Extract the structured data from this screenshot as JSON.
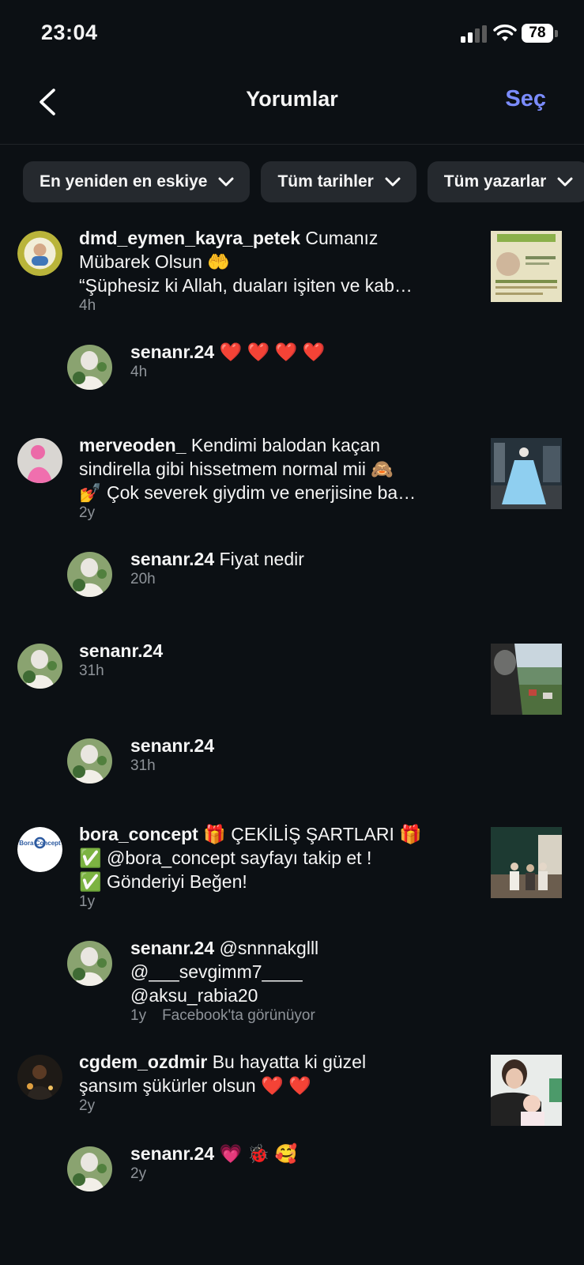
{
  "status_bar": {
    "time": "23:04",
    "battery": "78"
  },
  "header": {
    "title": "Yorumlar",
    "select": "Seç"
  },
  "filters": [
    {
      "label": "En yeniden en eskiye"
    },
    {
      "label": "Tüm tarihler"
    },
    {
      "label": "Tüm yazarlar"
    }
  ],
  "comments": [
    {
      "user": "dmd_eymen_kayra_petek",
      "line1": "Cumanız",
      "line2": "Mübarek Olsun 🤲",
      "line3": "“Şüphesiz ki Allah, duaları işiten ve kab…",
      "time": "4h",
      "reply": {
        "user": "senanr.24",
        "text": "❤️ ❤️ ❤️ ❤️",
        "time": "4h"
      }
    },
    {
      "user": "merveoden_",
      "line1": "Kendimi balodan kaçan",
      "line2": "sindirella gibi hissetmem normal mii 🙈",
      "line3": "💅 Çok severek giydim ve enerjisine ba…",
      "time": "2y",
      "reply": {
        "user": "senanr.24",
        "text": "Fiyat nedir",
        "time": "20h"
      }
    },
    {
      "user": "senanr.24",
      "line1": "",
      "time": "31h",
      "reply": {
        "user": "senanr.24",
        "text": "",
        "time": "31h"
      }
    },
    {
      "user": "bora_concept",
      "line1": "🎁 ÇEKİLİŞ ŞARTLARI 🎁",
      "line2": "✅ @bora_concept sayfayı takip et !",
      "line3": "✅ Gönderiyi Beğen!",
      "time": "1y",
      "avatar_text": "Bora Concept",
      "reply": {
        "user": "senanr.24",
        "text": "@snnnakglll",
        "line2": "@___sevgimm7____",
        "line3": "@aksu_rabia20",
        "time": "1y",
        "extra": "Facebook'ta görünüyor"
      }
    },
    {
      "user": "cgdem_ozdmir",
      "line1": "Bu hayatta ki  güzel",
      "line2": "şansım şükürler olsun ❤️ ❤️",
      "time": "2y",
      "reply": {
        "user": "senanr.24",
        "text": "💗 🐞 🥰",
        "time": "2y"
      }
    }
  ],
  "colors": {
    "background": "#0c1014",
    "accent": "#7b8cff",
    "chip": "#25292e",
    "muted": "#8e9399"
  }
}
